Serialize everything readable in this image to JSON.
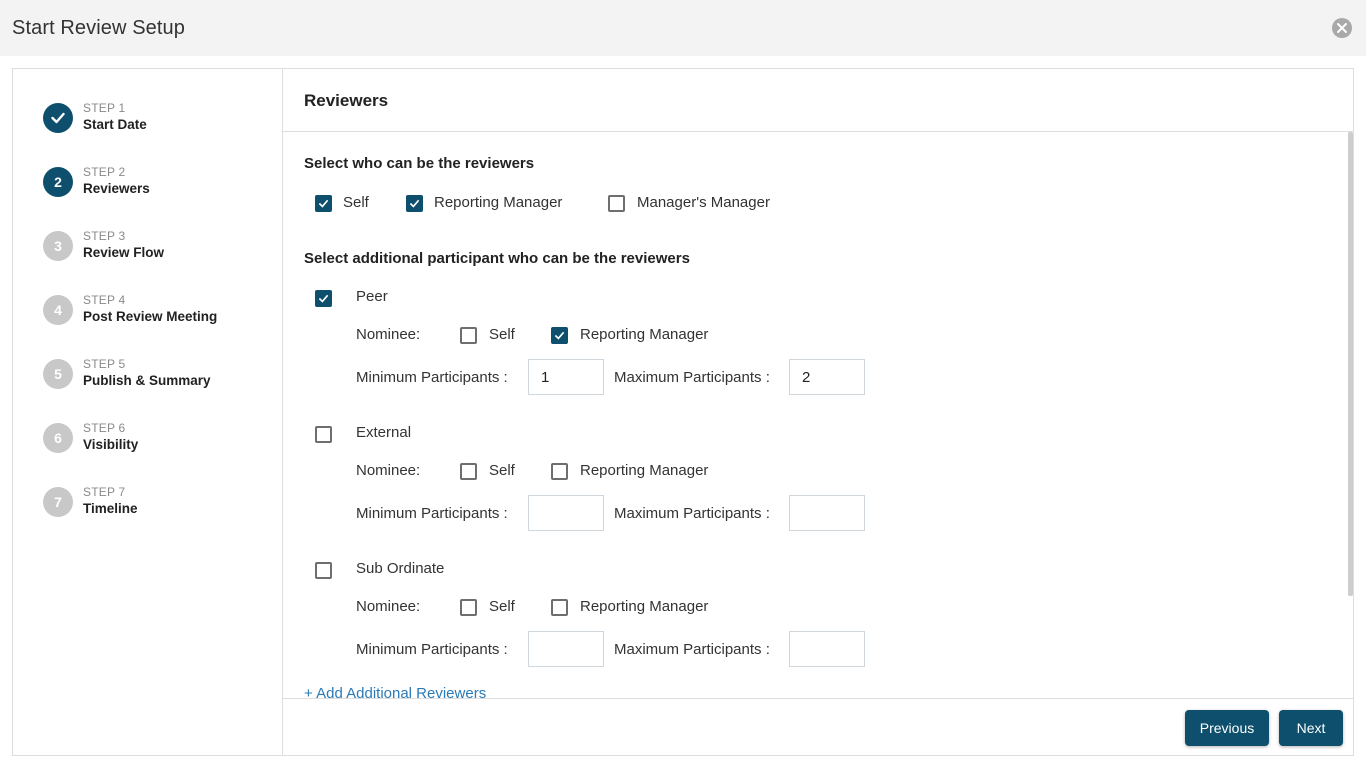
{
  "window": {
    "title": "Start Review Setup",
    "close_icon": "close-circle-icon"
  },
  "steps": [
    {
      "number": "STEP 1",
      "badge": "1",
      "name": "Start Date",
      "status": "done"
    },
    {
      "number": "STEP 2",
      "badge": "2",
      "name": "Reviewers",
      "status": "active"
    },
    {
      "number": "STEP 3",
      "badge": "3",
      "name": "Review Flow",
      "status": "pending"
    },
    {
      "number": "STEP 4",
      "badge": "4",
      "name": "Post Review Meeting",
      "status": "pending"
    },
    {
      "number": "STEP 5",
      "badge": "5",
      "name": "Publish & Summary",
      "status": "pending"
    },
    {
      "number": "STEP 6",
      "badge": "6",
      "name": "Visibility",
      "status": "pending"
    },
    {
      "number": "STEP 7",
      "badge": "7",
      "name": "Timeline",
      "status": "pending"
    }
  ],
  "main": {
    "heading": "Reviewers",
    "reviewers_section": {
      "title": "Select who can be the reviewers",
      "options": [
        {
          "label": "Self",
          "checked": true
        },
        {
          "label": "Reporting Manager",
          "checked": true
        },
        {
          "label": "Manager's Manager",
          "checked": false
        }
      ]
    },
    "additional_section": {
      "title": "Select additional participant who can be the reviewers",
      "nominee_label": "Nominee:",
      "min_label": "Minimum Participants :",
      "max_label": "Maximum Participants :",
      "participants": [
        {
          "label": "Peer",
          "checked": true,
          "nominee": [
            {
              "label": "Self",
              "checked": false
            },
            {
              "label": "Reporting Manager",
              "checked": true
            }
          ],
          "min": "1",
          "max": "2"
        },
        {
          "label": "External",
          "checked": false,
          "nominee": [
            {
              "label": "Self",
              "checked": false
            },
            {
              "label": "Reporting Manager",
              "checked": false
            }
          ],
          "min": "",
          "max": ""
        },
        {
          "label": "Sub Ordinate",
          "checked": false,
          "nominee": [
            {
              "label": "Self",
              "checked": false
            },
            {
              "label": "Reporting Manager",
              "checked": false
            }
          ],
          "min": "",
          "max": ""
        }
      ]
    },
    "add_link": "+ Add Additional Reviewers"
  },
  "footer": {
    "previous_label": "Previous",
    "next_label": "Next"
  },
  "colors": {
    "primary": "#0d4f6c",
    "step_inactive": "#c8c8c8",
    "link": "#2a7ab8"
  }
}
